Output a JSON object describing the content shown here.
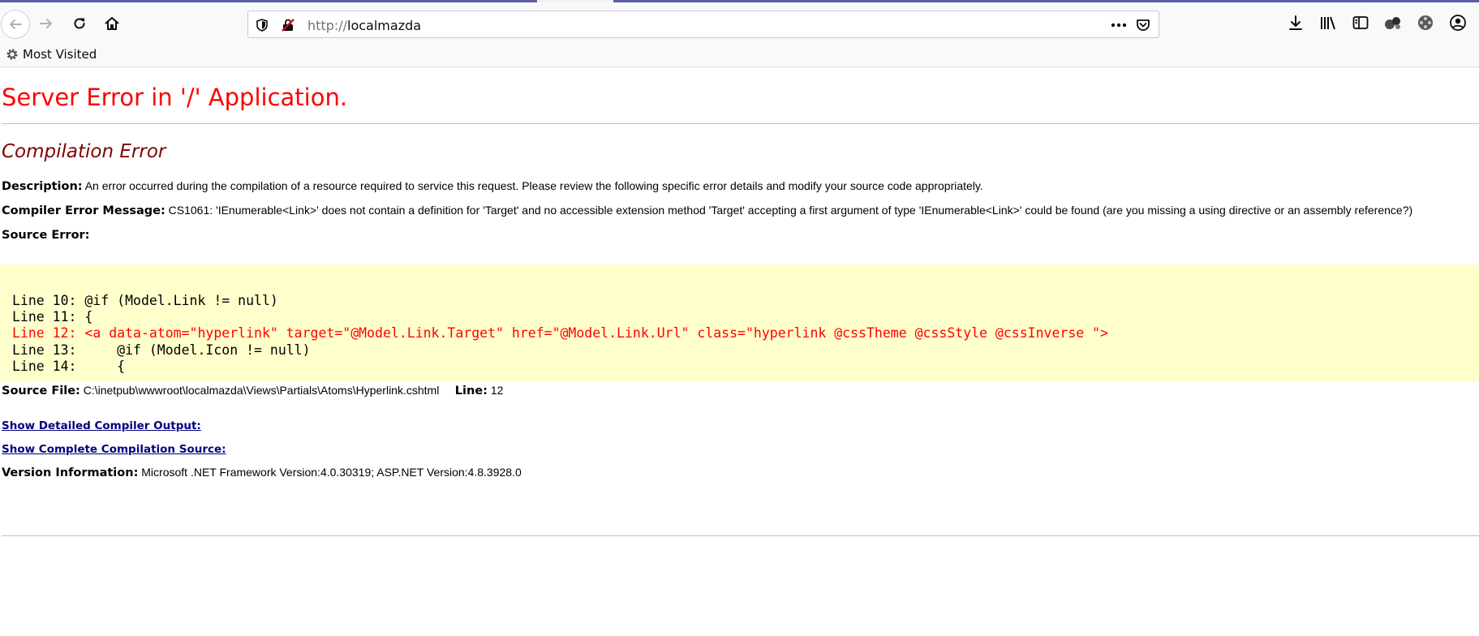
{
  "browser": {
    "url_protocol": "http://",
    "url_host": "localmazda",
    "bookmarks": [
      {
        "label": "Most Visited",
        "icon": "gear-icon"
      }
    ]
  },
  "page": {
    "title": "Server Error in '/' Application.",
    "subtitle": "Compilation Error",
    "description_label": "Description:",
    "description_text": "An error occurred during the compilation of a resource required to service this request. Please review the following specific error details and modify your source code appropriately.",
    "compiler_label": "Compiler Error Message:",
    "compiler_text": "CS1061: 'IEnumerable<Link>' does not contain a definition for 'Target' and no accessible extension method 'Target' accepting a first argument of type 'IEnumerable<Link>' could be found (are you missing a using directive or an assembly reference?)",
    "source_error_label": "Source Error:",
    "code_lines": [
      {
        "text": "Line 10: @if (Model.Link != null)",
        "error": false
      },
      {
        "text": "Line 11: {",
        "error": false
      },
      {
        "text": "Line 12: <a data-atom=\"hyperlink\" target=\"@Model.Link.Target\" href=\"@Model.Link.Url\" class=\"hyperlink @cssTheme @cssStyle @cssInverse \">",
        "error": true
      },
      {
        "text": "Line 13:     @if (Model.Icon != null)",
        "error": false
      },
      {
        "text": "Line 14:     {",
        "error": false
      }
    ],
    "source_file_label": "Source File:",
    "source_file_path": "C:\\inetpub\\wwwroot\\localmazda\\Views\\Partials\\Atoms\\Hyperlink.cshtml",
    "line_label": "Line:",
    "line_number": "12",
    "link_detailed": "Show Detailed Compiler Output:",
    "link_complete": "Show Complete Compilation Source:",
    "version_label": "Version Information:",
    "version_text": "Microsoft .NET Framework Version:4.0.30319; ASP.NET Version:4.8.3928.0"
  },
  "colors": {
    "title": "#ff0000",
    "subtitle": "#800000",
    "code_bg": "#ffffcc",
    "link": "#000080"
  }
}
